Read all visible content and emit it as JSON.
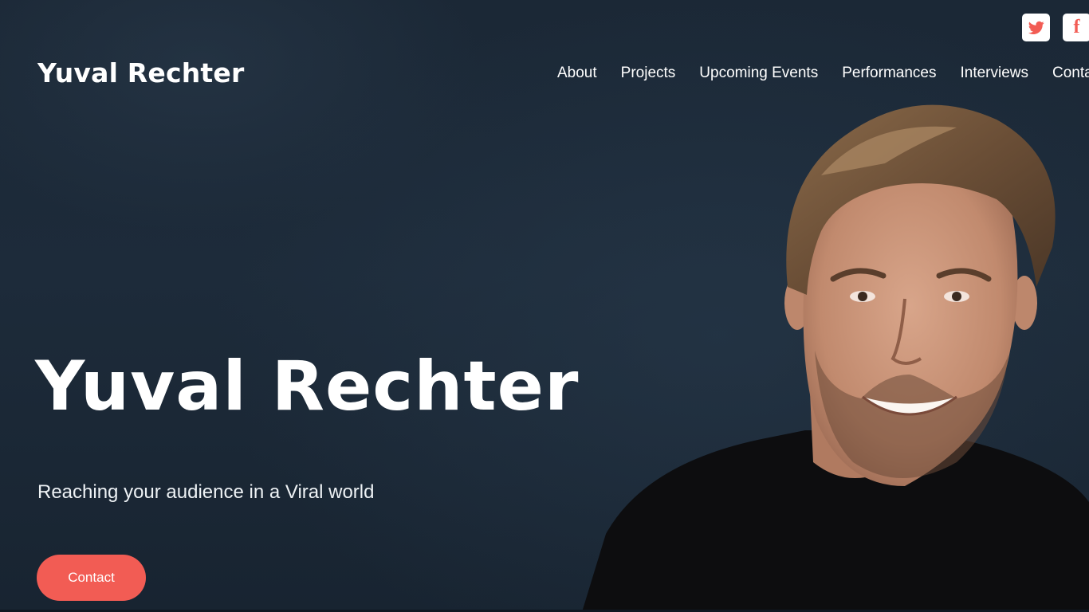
{
  "header": {
    "logo": "Yuval Rechter",
    "social": [
      {
        "name": "twitter",
        "icon": "twitter-icon",
        "glyph": ""
      },
      {
        "name": "facebook",
        "icon": "facebook-icon",
        "glyph": "f"
      }
    ],
    "nav": [
      "About",
      "Projects",
      "Upcoming Events",
      "Performances",
      "Interviews",
      "Contact"
    ]
  },
  "hero": {
    "title": "Yuval Rechter",
    "subtitle": "Reaching your audience in a Viral world",
    "cta_label": "Contact",
    "portrait_icon": "portrait-photo"
  },
  "colors": {
    "background": "#1c2a38",
    "accent": "#f25c54",
    "text": "#ffffff"
  }
}
